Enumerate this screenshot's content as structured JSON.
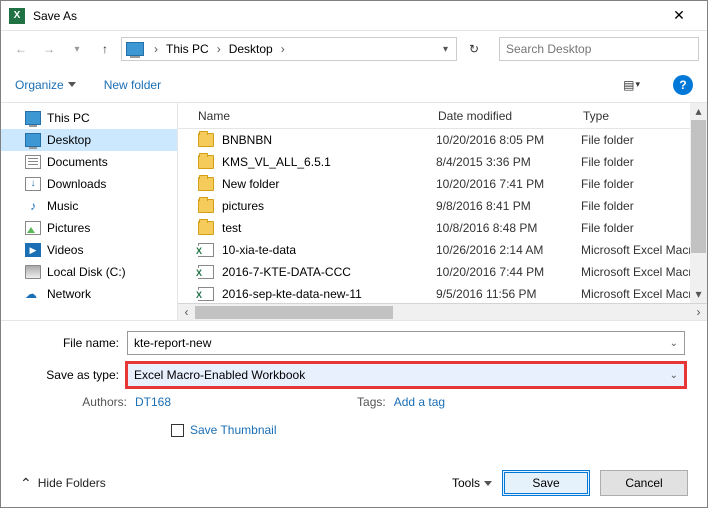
{
  "window": {
    "title": "Save As"
  },
  "nav": {
    "breadcrumb": [
      "This PC",
      "Desktop"
    ],
    "search_placeholder": "Search Desktop"
  },
  "toolbar": {
    "organize": "Organize",
    "new_folder": "New folder"
  },
  "sidebar": {
    "items": [
      {
        "label": "This PC",
        "icon": "monitor"
      },
      {
        "label": "Desktop",
        "icon": "monitor",
        "selected": true
      },
      {
        "label": "Documents",
        "icon": "doc"
      },
      {
        "label": "Downloads",
        "icon": "down"
      },
      {
        "label": "Music",
        "icon": "music"
      },
      {
        "label": "Pictures",
        "icon": "pic"
      },
      {
        "label": "Videos",
        "icon": "vid"
      },
      {
        "label": "Local Disk (C:)",
        "icon": "disk"
      },
      {
        "label": "Network",
        "icon": "net"
      }
    ]
  },
  "columns": {
    "name": "Name",
    "date": "Date modified",
    "type": "Type"
  },
  "files": [
    {
      "name": "BNBNBN",
      "date": "10/20/2016 8:05 PM",
      "type": "File folder",
      "icon": "folder"
    },
    {
      "name": "KMS_VL_ALL_6.5.1",
      "date": "8/4/2015 3:36 PM",
      "type": "File folder",
      "icon": "folder"
    },
    {
      "name": "New folder",
      "date": "10/20/2016 7:41 PM",
      "type": "File folder",
      "icon": "folder"
    },
    {
      "name": "pictures",
      "date": "9/8/2016 8:41 PM",
      "type": "File folder",
      "icon": "folder"
    },
    {
      "name": "test",
      "date": "10/8/2016 8:48 PM",
      "type": "File folder",
      "icon": "folder"
    },
    {
      "name": "10-xia-te-data",
      "date": "10/26/2016 2:14 AM",
      "type": "Microsoft Excel Macro-",
      "icon": "xlsm"
    },
    {
      "name": "2016-7-KTE-DATA-CCC",
      "date": "10/20/2016 7:44 PM",
      "type": "Microsoft Excel Macro-",
      "icon": "xlsm"
    },
    {
      "name": "2016-sep-kte-data-new-11",
      "date": "9/5/2016 11:56 PM",
      "type": "Microsoft Excel Macro-",
      "icon": "xlsm"
    }
  ],
  "form": {
    "file_name_label": "File name:",
    "file_name_value": "kte-report-new",
    "save_type_label": "Save as type:",
    "save_type_value": "Excel Macro-Enabled Workbook",
    "authors_label": "Authors:",
    "authors_value": "DT168",
    "tags_label": "Tags:",
    "tags_value": "Add a tag",
    "save_thumbnail": "Save Thumbnail"
  },
  "footer": {
    "hide_folders": "Hide Folders",
    "tools": "Tools",
    "save": "Save",
    "cancel": "Cancel"
  }
}
